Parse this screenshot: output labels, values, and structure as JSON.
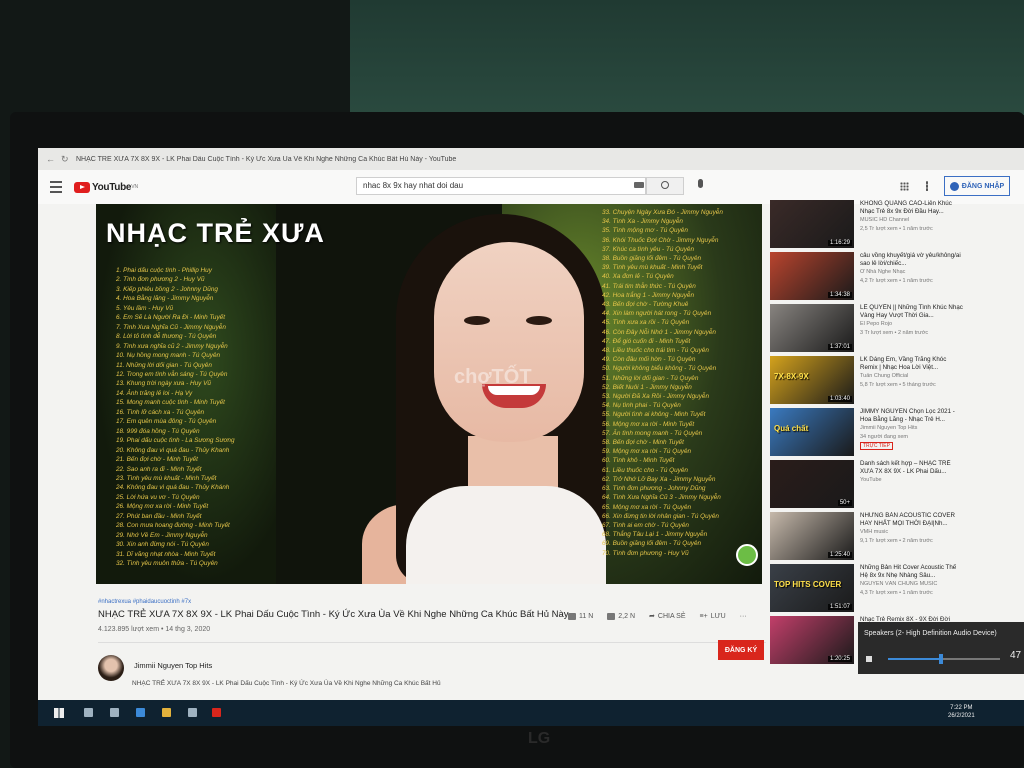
{
  "window": {
    "title": "NHẠC TRẺ XƯA 7X 8X 9X - LK Phai Dấu Cuộc Tình - Ký Ức Xưa Ùa Về Khi Nghe Những Ca Khúc Bất Hủ Này - YouTube"
  },
  "header": {
    "logo_text": "YouTube",
    "logo_region": "VN",
    "search_value": "nhac 8x 9x hay nhat doi dau",
    "signin_label": "ĐĂNG NHẬP"
  },
  "player": {
    "title_overlay": "NHẠC TRẺ XƯA",
    "watermark": "chợTỐT",
    "songs_left": [
      "1. Phai dấu cuộc tình - Phillip Huy",
      "2. Tình đơn phương 2 - Huy Vũ",
      "3. Kiếp phiêu bồng 2 - Johnny Dũng",
      "4. Hoa Bằng lăng - Jimmy Nguyễn",
      "5. Yêu lầm - Huy Vũ",
      "6. Em Sẽ Là Người Ra Đi - Minh Tuyết",
      "7. Tình Xưa Nghĩa Cũ - Jimmy Nguyễn",
      "8. Lời tỏ tình dễ thương - Tú Quyên",
      "9. Tình xưa nghĩa cũ 2 - Jimmy Nguyễn",
      "10. Nụ hồng mong manh - Tú Quyên",
      "11. Những lời dối gian - Tú Quyên",
      "12. Trong em tình vẫn sáng - Tú Quyên",
      "13. Khung trời ngày xưa - Huy Vũ",
      "14. Ảnh trăng lẻ loi - Hạ Vy",
      "15. Mong manh cuộc tình - Minh Tuyết",
      "16. Tình lỡ cách xa - Tú Quyên",
      "17. Em quên mùa đông - Tú Quyên",
      "18. 999 đóa hồng - Tú Quyên",
      "19. Phai dấu cuộc tình - La Sương Sương",
      "20. Không đau vì quá đau - Thủy Khanh",
      "21. Bến đợi chờ - Minh Tuyết",
      "22. Sao anh ra đi - Minh Tuyết",
      "23. Tình yêu mù khuất - Minh Tuyết",
      "24. Không đau vì quá đau - Thủy Khánh",
      "25. Lời hứa vu vơ - Tú Quyên",
      "26. Mộng mơ xa rời - Minh Tuyết",
      "27. Phút ban đầu - Minh Tuyết",
      "28. Con mưa hoang đường - Minh Tuyết",
      "29. Nhớ Về Em - Jimmy Nguyễn",
      "30. Xin anh đừng nói - Tú Quyên",
      "31. Dĩ vãng nhạt nhòa - Minh Tuyết",
      "32. Tình yêu muôn thửa - Tú Quyên"
    ],
    "songs_right": [
      "33. Chuyện Ngày Xưa Đó - Jimmy Nguyễn",
      "34. Tình Xa - Jimmy Nguyễn",
      "35. Tình mộng mơ - Tú Quyên",
      "36. Khói Thuốc Đợi Chờ - Jimmy Nguyễn",
      "37. Khúc ca tình yêu - Tú Quyên",
      "38. Buồn giăng lối đêm - Tú Quyên",
      "39. Tình yêu mù khuất - Minh Tuyết",
      "40. Xa đơn lẻ - Tú Quyên",
      "41. Trái tim thẫn thức - Tú Quyên",
      "42. Hoa trắng 1 - Jimmy Nguyễn",
      "43. Bến đợi chờ - Tường Khuê",
      "44. Xin làm người hát rong - Tú Quyên",
      "45. Tình xưa xa rồi - Tú Quyên",
      "46. Còn Đây Nỗi Nhớ 1 - Jimmy Nguyễn",
      "47. Để gió cuốn đi - Minh Tuyết",
      "48. Liều thuốc cho trái tim - Tú Quyên",
      "49. Còn đâu mối hờn - Tú Quyên",
      "50. Người không biểu không - Tú Quyên",
      "51. Những lời dối gian - Tú Quyên",
      "52. Biết Nuôi 1 - Jimmy Nguyễn",
      "53. Người Đã Xa Rồi - Jimmy Nguyễn",
      "54. Nụ tình phai - Tú Quyên",
      "55. Người tình ai không - Minh Tuyết",
      "56. Mộng mơ xa rời - Minh Tuyết",
      "57. Ăn tình mong manh - Tú Quyên",
      "58. Bến đợi chờ - Minh Tuyết",
      "59. Mộng mơ xa rời - Tú Quyên",
      "60. Tình khô - Minh Tuyết",
      "61. Liều thuốc cho - Tú Quyên",
      "62. Trở Nhớ Lỡ Bay Xa - Jimmy Nguyễn",
      "63. Tình đơn phương - Johnny Dũng",
      "64. Tình Xưa Nghĩa Cũ 3 - Jimmy Nguyễn",
      "65. Mộng mơ xa rời - Tú Quyên",
      "66. Xin đừng tin lời nhân gian - Tú Quyên",
      "67. Tình ai em chờ - Tú Quyên",
      "68. Thắng Tâu Lại 1 - Jimmy Nguyễn",
      "69. Buồn giăng lối đêm - Tú Quyên",
      "70. Tình đơn phương - Huy Vũ"
    ]
  },
  "video": {
    "hashtags": "#nhactrexua #phaidaucuoctinh #7x",
    "title": "NHẠC TRẺ XƯA 7X 8X 9X - LK Phai Dấu Cuộc Tình - Ký Ức Xưa Ùa Về Khi Nghe Những Ca Khúc Bất Hủ Này",
    "views": "4.123.895 lượt xem • 14 thg 3, 2020",
    "likes": "11 N",
    "dislikes": "2,2 N",
    "share_label": "CHIA SẺ",
    "save_label": "LƯU",
    "channel": "Jimmii Nguyen Top Hits",
    "subscribe_label": "ĐĂNG KÝ",
    "description": "NHẠC TRẺ XƯA 7X 8X 9X - LK Phai Dấu Cuộc Tình - Ký Ức Xưa Ùa Về Khi Nghe Những Ca Khúc Bất Hủ"
  },
  "sidebar": [
    {
      "title": "KHÔNG QUẢNG CÁO-Liên Khúc Nhạc Trẻ 8x 9x Đời Đầu Hay...",
      "channel": "MUSIC HD Channel",
      "meta": "2,5 Tr lượt xem • 1 năm trước",
      "duration": "1:16:29",
      "thumb_color": "#3a2a28"
    },
    {
      "title": "câu vồng khuyết/giá vờ yêu/không/ai sao lê lời/chiếc...",
      "channel": "Ở Nhà Nghe Nhạc",
      "meta": "4,2 Tr lượt xem • 1 năm trước",
      "duration": "1:34:38",
      "thumb_color": "#b9442e"
    },
    {
      "title": "LÊ QUYÊN || Những Tình Khúc Nhạc Vàng Hay Vượt Thời Gia...",
      "channel": "El Pepo Rojo",
      "meta": "3 Tr lượt xem • 2 năm trước",
      "duration": "1:37:01",
      "thumb_color": "#888480"
    },
    {
      "title": "LK Dáng Em, Vầng Trăng Khóc Remix | Nhạc Hoa Lời Việt...",
      "channel": "Tuấn Chung Official",
      "meta": "5,8 Tr lượt xem • 5 tháng trước",
      "duration": "1:03:40",
      "thumb_color": "#d4a21c",
      "thumb_text": "7X-8X-9X"
    },
    {
      "title": "JIMMY NGUYEN Chọn Lọc 2021 - Hoa Bằng Lăng - Nhạc Trẻ H...",
      "channel": "Jimmii Nguyen Top Hits",
      "meta": "34 người đang xem",
      "live": "TRỰC TIẾP",
      "thumb_color": "#3a7ac0",
      "thumb_text": "Quá chất"
    },
    {
      "title": "Danh sách kết hợp – NHẠC TRẺ XƯA 7X 8X 9X - LK Phai Dấu...",
      "channel": "YouTube",
      "meta": "",
      "duration": "50+",
      "thumb_color": "#2a1c1a"
    },
    {
      "title": "NHỮNG BẢN ACOUSTIC COVER HAY NHẤT MỌI THỜI ĐẠI|Nh...",
      "channel": "VMH music",
      "meta": "9,1 Tr lượt xem • 2 năm trước",
      "duration": "1:25:40",
      "thumb_color": "#c6b9ab"
    },
    {
      "title": "Những Bản Hit Cover Acoustic Thế Hệ 8x 9x Nhẹ Nhàng Sâu...",
      "channel": "NGUYỄN VĂN CHUNG MUSIC",
      "meta": "4,3 Tr lượt xem • 1 năm trước",
      "duration": "1:51:07",
      "thumb_color": "#3a4048",
      "thumb_text": "TOP HITS COVER"
    },
    {
      "title": "Nhạc Trẻ Remix 8X - 9X Đời Đời",
      "channel": "",
      "meta": "",
      "duration": "1:20:25",
      "thumb_color": "#c23f6a"
    }
  ],
  "volume_popup": {
    "label": "Speakers (2- High Definition Audio Device)",
    "level": 47
  },
  "taskbar": {
    "time": "7:22 PM",
    "date": "26/2/2021"
  },
  "monitor_brand": "LG"
}
